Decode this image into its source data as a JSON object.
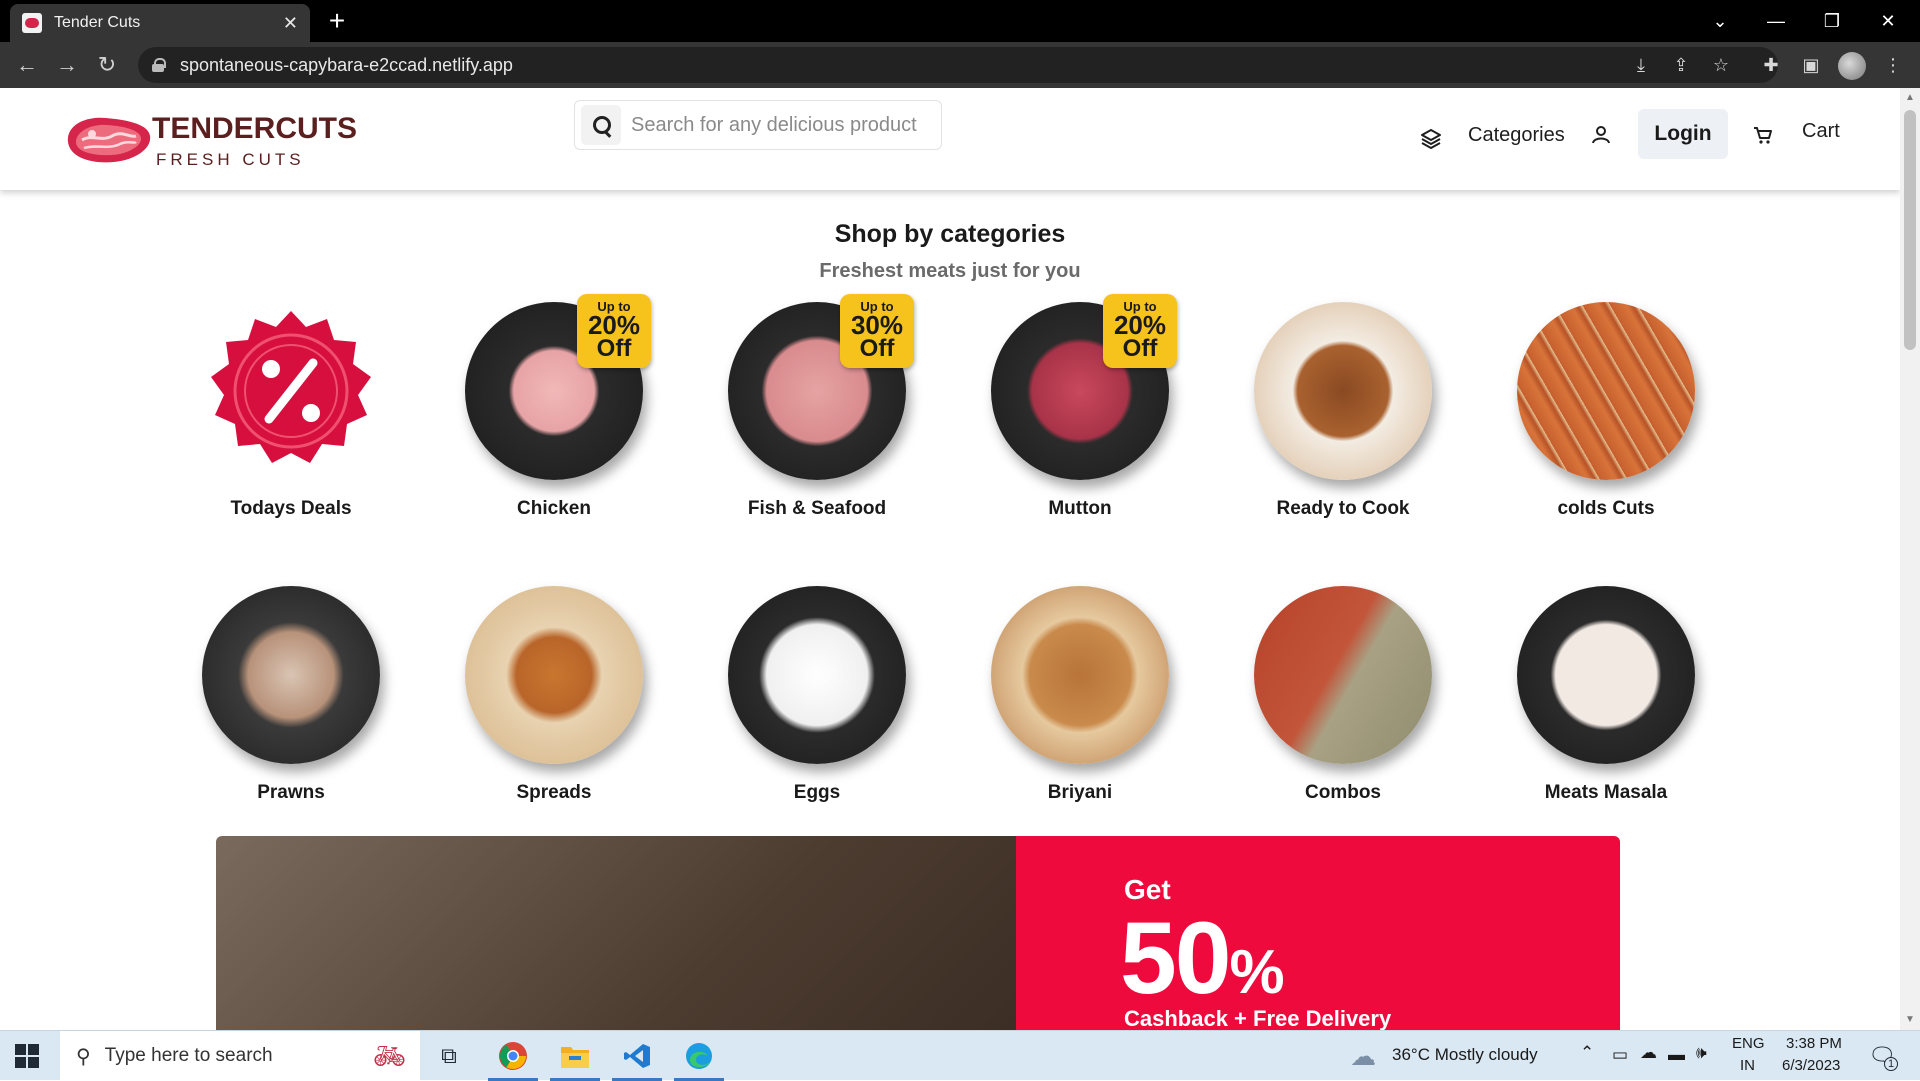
{
  "browser": {
    "tab_title": "Tender Cuts",
    "url": "spontaneous-capybara-e2ccad.netlify.app"
  },
  "header": {
    "brand": "TENDERCUTS",
    "brand_sub": "FRESH CUTS",
    "search_placeholder": "Search for any delicious product",
    "nav_categories": "Categories",
    "nav_login": "Login",
    "nav_cart": "Cart"
  },
  "section": {
    "title": "Shop by categories",
    "subtitle": "Freshest meats just for you"
  },
  "categories": [
    {
      "label": "Todays Deals",
      "icon": "percent-badge-icon"
    },
    {
      "label": "Chicken",
      "badge": {
        "top": "Up to",
        "value": "20%",
        "bottom": "Off"
      }
    },
    {
      "label": "Fish & Seafood",
      "badge": {
        "top": "Up to",
        "value": "30%",
        "bottom": "Off"
      }
    },
    {
      "label": "Mutton",
      "badge": {
        "top": "Up to",
        "value": "20%",
        "bottom": "Off"
      }
    },
    {
      "label": "Ready to Cook"
    },
    {
      "label": "colds Cuts"
    },
    {
      "label": "Prawns"
    },
    {
      "label": "Spreads"
    },
    {
      "label": "Eggs"
    },
    {
      "label": "Briyani"
    },
    {
      "label": "Combos"
    },
    {
      "label": "Meats Masala"
    }
  ],
  "banner": {
    "get": "Get",
    "value": "50",
    "percent": "%",
    "offer": "Cashback + Free Delivery"
  },
  "taskbar": {
    "search_placeholder": "Type here to search",
    "weather": "36°C  Mostly cloudy",
    "lang_top": "ENG",
    "lang_bottom": "IN",
    "time": "3:38 PM",
    "date": "6/3/2023",
    "notification_count": "1"
  },
  "colors": {
    "accent_red": "#ee0a3c",
    "brand_maroon": "#5c1f1f",
    "badge_yellow": "#f6c21c"
  }
}
